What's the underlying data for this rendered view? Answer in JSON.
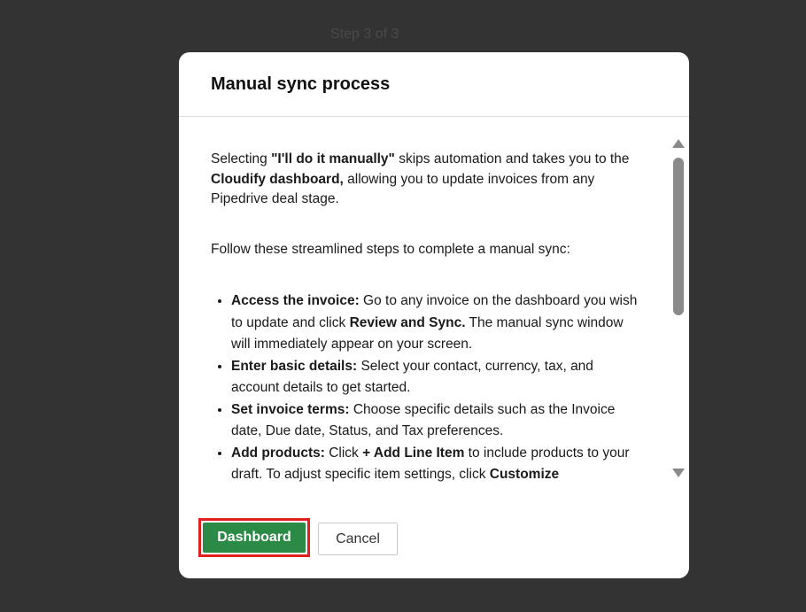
{
  "step_label": "Step 3 of 3",
  "modal": {
    "title": "Manual sync process",
    "intro": {
      "t1": "Selecting ",
      "b1": "\"I'll do it manually\"",
      "t2": " skips automation and takes you to the ",
      "b2": "Cloudify dashboard,",
      "t3": " allowing you to update invoices from any Pipedrive deal stage."
    },
    "follow_text": "Follow these streamlined steps to complete a manual sync:",
    "steps": [
      {
        "b1": "Access the invoice:",
        "t1": " Go to any invoice on the dashboard you wish to update and click ",
        "b2": "Review and Sync.",
        "t2": " The manual sync window will immediately appear on your screen."
      },
      {
        "b1": "Enter basic details:",
        "t1": " Select your contact, currency, tax, and account details to get started."
      },
      {
        "b1": "Set invoice terms:",
        "t1": " Choose specific details such as the Invoice date, Due date, Status, and Tax preferences."
      },
      {
        "b1": "Add products:",
        "t1": " Click ",
        "b2": "+ Add Line Item",
        "t2": " to include products to your draft. To adjust specific item settings, click ",
        "b3": "Customize"
      }
    ],
    "buttons": {
      "dashboard": "Dashboard",
      "cancel": "Cancel"
    }
  },
  "colors": {
    "backdrop": "#333333",
    "primary_button": "#2b8a45",
    "highlight_border": "#e0201e"
  },
  "icons": {
    "scroll_up": "triangle-up",
    "scroll_down": "triangle-down"
  }
}
